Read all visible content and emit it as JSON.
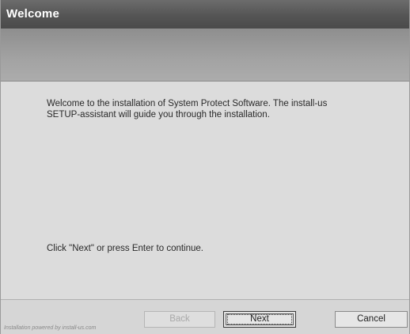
{
  "window": {
    "title": "Welcome"
  },
  "content": {
    "welcome_line1": "Welcome to the installation of System Protect Software. The install-us",
    "welcome_line2": "SETUP-assistant will guide you through the installation.",
    "continue_text": "Click \"Next\" or press Enter to continue."
  },
  "footer": {
    "powered_by": "Installation powered by install-us.com",
    "back_label": "Back",
    "next_label": "Next",
    "cancel_label": "Cancel"
  }
}
